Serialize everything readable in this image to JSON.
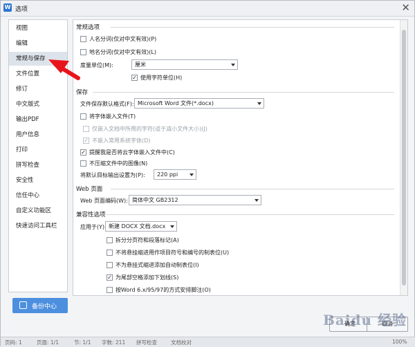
{
  "window": {
    "title": "选项",
    "close_glyph": "✕"
  },
  "sidebar": {
    "items": [
      {
        "label": "视图"
      },
      {
        "label": "编辑"
      },
      {
        "label": "常规与保存",
        "active": true
      },
      {
        "label": "文件位置"
      },
      {
        "label": "修订"
      },
      {
        "label": "中文版式"
      },
      {
        "label": "输出PDF"
      },
      {
        "label": "用户信息"
      },
      {
        "label": "打印"
      },
      {
        "label": "拼写检查"
      },
      {
        "label": "安全性"
      },
      {
        "label": "信任中心"
      },
      {
        "label": "自定义功能区"
      },
      {
        "label": "快速访问工具栏"
      }
    ],
    "backup_button": "备份中心"
  },
  "general": {
    "heading": "常规选项",
    "person_name": {
      "label": "人名分词(仅对中文有效)(P)",
      "checked": false
    },
    "place_name": {
      "label": "地名分词(仅对中文有效)(L)",
      "checked": false
    },
    "unit_label": "度量单位(M):",
    "unit_value": "厘米",
    "char_unit": {
      "label": "使用字符单位(H)",
      "checked": true
    }
  },
  "save": {
    "heading": "保存",
    "format_label": "文件保存默认格式(F):",
    "format_value": "Microsoft Word 文件(*.docx)",
    "embed_fonts": {
      "label": "将字体嵌入文件(T)",
      "checked": false
    },
    "embed_used_only": {
      "label": "仅嵌入文档中所用的字符(适于减小文件大小)(J)",
      "checked": false
    },
    "no_common_fonts": {
      "label": "不嵌入常用系统字体(D)",
      "checked": true
    },
    "cloud_fonts": {
      "label": "提醒我是否将云字体嵌入文件中(C)",
      "checked": true
    },
    "no_compress": {
      "label": "不压缩文件中的图像(N)",
      "checked": false
    },
    "resolution_label": "将默认目标输出设置为(P):",
    "resolution_value": "220 ppi"
  },
  "web": {
    "heading": "Web 页面",
    "encoding_label": "Web 页面编码(W):",
    "encoding_value": "简体中文 GB2312"
  },
  "compat": {
    "heading": "兼容性选项",
    "apply_label": "应用于(Y):",
    "apply_value": "新建 DOCX 文档.docx",
    "split_page": {
      "label": "拆分分页符和段落标记(A)",
      "checked": false
    },
    "underline_track": {
      "label": "不将悬挂缩进用作项目符号和编号的制表位(U)",
      "checked": false
    },
    "auto_tab": {
      "label": "不为悬挂式缩进添加自动制表位(I)",
      "checked": false
    },
    "trailing_underline": {
      "label": "为尾部空格添加下划线(S)",
      "checked": true
    },
    "word6_footnote": {
      "label": "按Word 6.x/95/97的方式安排脚注(O)",
      "checked": false
    }
  },
  "footer": {
    "ok": "确定",
    "cancel": "取消"
  },
  "statusbar": {
    "items": [
      "页码: 1",
      "页面: 1/1",
      "节: 1/1",
      "字数: 211",
      "拼写检查",
      "文档校对"
    ],
    "zoom": "100%"
  },
  "watermark": "Baidu 经验",
  "annotation": {
    "arrow_color": "#e8141b"
  }
}
